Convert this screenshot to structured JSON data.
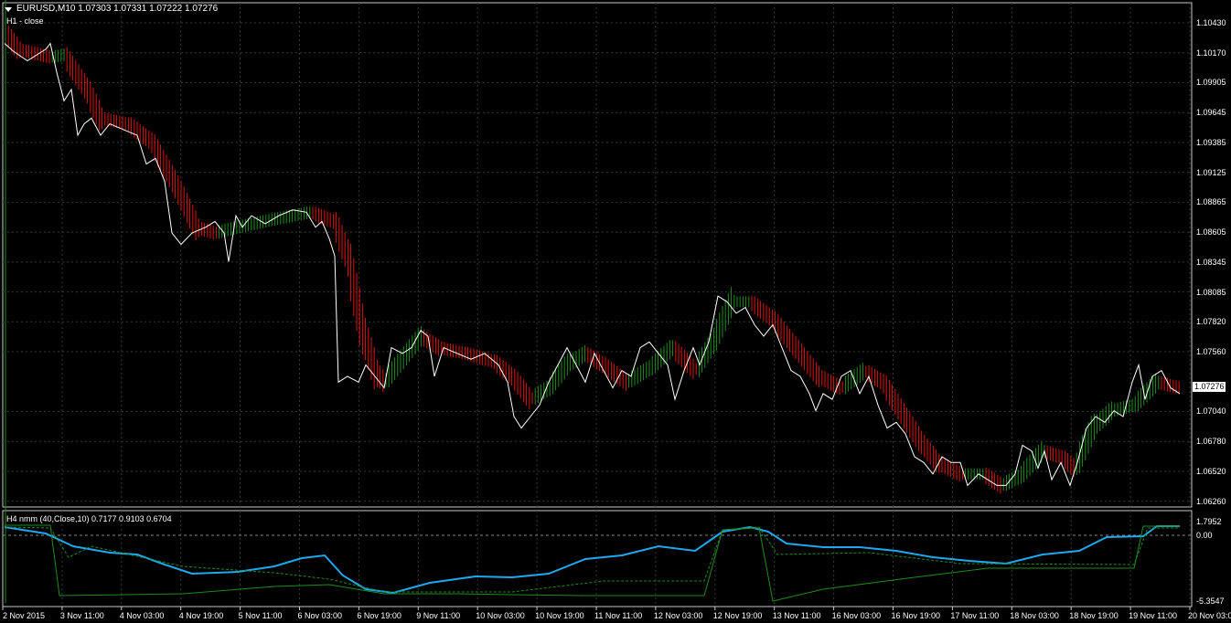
{
  "header": {
    "symbol_line": "EURUSD,M10  1.07303 1.07331 1.07222 1.07276",
    "subtitle": "H1 - close"
  },
  "indicator": {
    "label": "H4 nmm (40,Close,10) 0.7177 0.9103 0.6704",
    "y_ticks": [
      "1.7952",
      "0.00",
      "-5.3547"
    ]
  },
  "current_price": "1.07276",
  "price_axis": [
    "1.10430",
    "1.10170",
    "1.09905",
    "1.09645",
    "1.09385",
    "1.09125",
    "1.08865",
    "1.08605",
    "1.08345",
    "1.08085",
    "1.07820",
    "1.07560",
    "1.07040",
    "1.06780",
    "1.06520",
    "1.06260"
  ],
  "time_axis": [
    "2 Nov 2015",
    "3 Nov 11:00",
    "4 Nov 03:00",
    "4 Nov 19:00",
    "5 Nov 11:00",
    "6 Nov 03:00",
    "6 Nov 19:00",
    "9 Nov 11:00",
    "10 Nov 03:00",
    "10 Nov 19:00",
    "11 Nov 11:00",
    "12 Nov 03:00",
    "12 Nov 19:00",
    "13 Nov 11:00",
    "16 Nov 03:00",
    "16 Nov 19:00",
    "17 Nov 11:00",
    "18 Nov 03:00",
    "18 Nov 19:00",
    "19 Nov 11:00",
    "20 Nov 03:00"
  ],
  "colors": {
    "background": "#000000",
    "grid": "#2f3d3d",
    "frame": "#c8c8c8",
    "up_bar": "#1e8c1e",
    "down_bar": "#e01010",
    "close_line": "#ffffff",
    "indicator_main": "#1ea8f0",
    "indicator_green": "#1e8c1e"
  },
  "chart_data": {
    "type": "line",
    "series": [
      {
        "name": "H1 - close",
        "x": [
          "2 Nov 2015",
          "3 Nov 11:00",
          "4 Nov 03:00",
          "4 Nov 19:00",
          "5 Nov 11:00",
          "6 Nov 03:00",
          "6 Nov 19:00",
          "9 Nov 11:00",
          "10 Nov 03:00",
          "10 Nov 19:00",
          "11 Nov 11:00",
          "12 Nov 03:00",
          "12 Nov 19:00",
          "13 Nov 11:00",
          "16 Nov 03:00",
          "16 Nov 19:00",
          "17 Nov 11:00",
          "18 Nov 03:00",
          "18 Nov 19:00",
          "19 Nov 11:00",
          "20 Nov 03:00"
        ],
        "values": [
          1.103,
          1.0995,
          1.095,
          1.086,
          1.087,
          1.087,
          1.0735,
          1.077,
          1.072,
          1.071,
          1.0745,
          1.0735,
          1.0805,
          1.0755,
          1.073,
          1.071,
          1.066,
          1.064,
          1.0655,
          1.071,
          1.072
        ]
      }
    ],
    "ylim": [
      1.062,
      1.106
    ]
  }
}
